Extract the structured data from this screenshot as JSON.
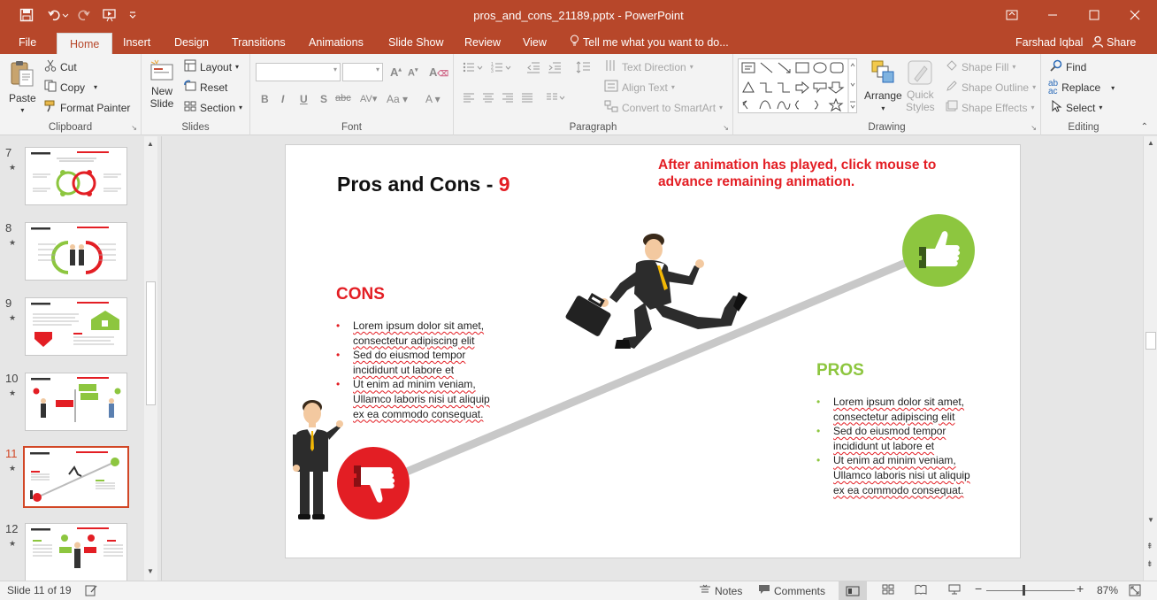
{
  "window": {
    "title": "pros_and_cons_21189.pptx - PowerPoint"
  },
  "tabs": {
    "file": "File",
    "home": "Home",
    "insert": "Insert",
    "design": "Design",
    "transitions": "Transitions",
    "animations": "Animations",
    "slideshow": "Slide Show",
    "review": "Review",
    "view": "View",
    "tellme": "Tell me what you want to do...",
    "user": "Farshad Iqbal",
    "share": "Share"
  },
  "ribbon": {
    "clipboard": {
      "paste": "Paste",
      "cut": "Cut",
      "copy": "Copy",
      "format_painter": "Format Painter",
      "label": "Clipboard"
    },
    "slides": {
      "new_slide_1": "New",
      "new_slide_2": "Slide",
      "layout": "Layout",
      "reset": "Reset",
      "section": "Section",
      "label": "Slides"
    },
    "font": {
      "label": "Font"
    },
    "paragraph": {
      "text_direction": "Text Direction",
      "align_text": "Align Text",
      "convert_smartart": "Convert to SmartArt",
      "label": "Paragraph"
    },
    "drawing": {
      "arrange": "Arrange",
      "quick_styles_1": "Quick",
      "quick_styles_2": "Styles",
      "shape_fill": "Shape Fill",
      "shape_outline": "Shape Outline",
      "shape_effects": "Shape Effects",
      "label": "Drawing"
    },
    "editing": {
      "find": "Find",
      "replace": "Replace",
      "select": "Select",
      "label": "Editing"
    }
  },
  "thumbnails": [
    {
      "num": "7",
      "star": "★"
    },
    {
      "num": "8",
      "star": "★"
    },
    {
      "num": "9",
      "star": "★"
    },
    {
      "num": "10",
      "star": "★"
    },
    {
      "num": "11",
      "star": "★"
    },
    {
      "num": "12",
      "star": "★"
    }
  ],
  "slide": {
    "title_prefix": "Pros and Cons - ",
    "title_num": "9",
    "note": "After animation has played, click mouse to advance remaining animation.",
    "cons": {
      "heading": "CONS",
      "items": [
        [
          "Lorem ipsum dolor sit amet,",
          "consectetur adipiscing elit"
        ],
        [
          "Sed do eiusmod tempor",
          "incididunt ut labore et"
        ],
        [
          "Ut enim ad minim veniam,",
          "Ullamco laboris nisi ut aliquip",
          "ex ea commodo consequat."
        ]
      ]
    },
    "pros": {
      "heading": "PROS",
      "items": [
        [
          "Lorem ipsum dolor sit amet,",
          "consectetur adipiscing elit"
        ],
        [
          "Sed do eiusmod tempor",
          "incididunt ut labore et"
        ],
        [
          "Ut enim ad minim veniam,",
          "Ullamco laboris nisi ut aliquip",
          "ex ea commodo consequat."
        ]
      ]
    },
    "colors": {
      "red": "#e31e24",
      "green": "#8dc63f"
    }
  },
  "status": {
    "slide_of": "Slide 11 of 19",
    "notes": "Notes",
    "comments": "Comments",
    "zoom": "87%"
  }
}
